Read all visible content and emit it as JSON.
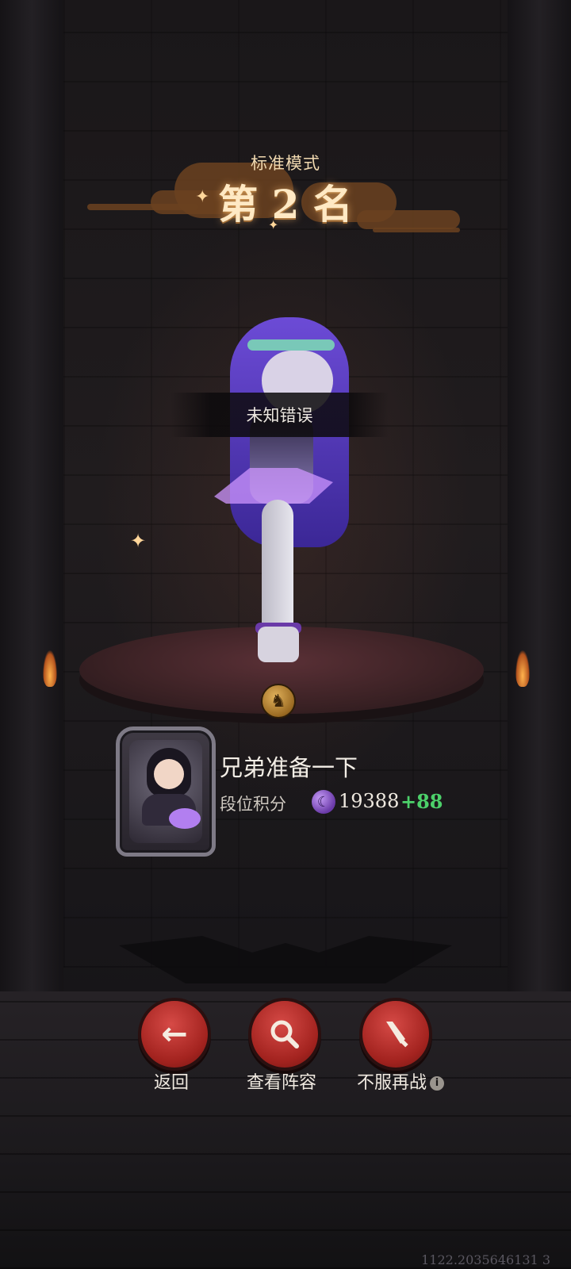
{
  "header": {
    "mode_label": "标准模式",
    "rank_text": "第 2 名"
  },
  "toast": {
    "message": "未知错误"
  },
  "player": {
    "name": "兄弟准备一下",
    "score_label": "段位积分",
    "score_value": "19388",
    "score_delta": "+88"
  },
  "actions": {
    "back_label": "返回",
    "view_lineup_label": "查看阵容",
    "rematch_label": "不服再战"
  },
  "footer": {
    "coordinates": "1122.2035646131 3"
  },
  "icons": {
    "back": "arrow-left-icon",
    "view_lineup": "magnifier-icon",
    "rematch": "sword-icon",
    "info": "info-icon",
    "rank": "crescent-rank-icon",
    "medal": "horse-medal-icon"
  },
  "colors": {
    "accent_red": "#a3231f",
    "delta_green": "#4cd06a",
    "gold_title": "#ffe9c4"
  }
}
